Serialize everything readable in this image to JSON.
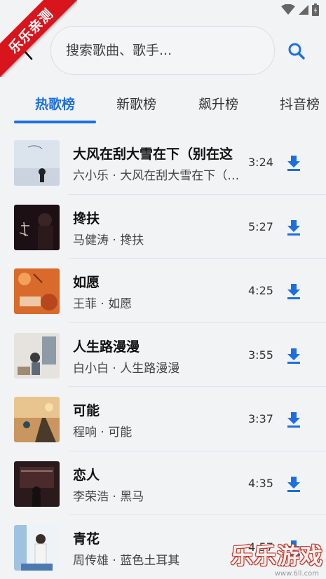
{
  "ribbon": {
    "label": "乐乐亲测"
  },
  "search": {
    "placeholder": "搜索歌曲、歌手..."
  },
  "tabs": [
    {
      "label": "热歌榜",
      "active": true
    },
    {
      "label": "新歌榜",
      "active": false
    },
    {
      "label": "飙升榜",
      "active": false
    },
    {
      "label": "抖音榜",
      "active": false
    }
  ],
  "songs": [
    {
      "title": "大风在刮大雪在下（别在这",
      "subtitle": "六小乐 · 大风在刮大雪在下（…",
      "duration": "3:24"
    },
    {
      "title": "搀扶",
      "subtitle": "马健涛 · 搀扶",
      "duration": "5:27"
    },
    {
      "title": "如愿",
      "subtitle": "王菲 · 如愿",
      "duration": "4:25"
    },
    {
      "title": "人生路漫漫",
      "subtitle": "白小白 · 人生路漫漫",
      "duration": "3:55"
    },
    {
      "title": "可能",
      "subtitle": "程响 · 可能",
      "duration": "3:37"
    },
    {
      "title": "恋人",
      "subtitle": "李荣浩 · 黑马",
      "duration": "4:35"
    },
    {
      "title": "青花",
      "subtitle": "周传雄 · 蓝色土耳其",
      "duration": "4:57"
    }
  ],
  "watermark": {
    "text": "乐乐游戏",
    "url": "www.6ll.com"
  },
  "colors": {
    "accent": "#1d6fe0",
    "ribbon": "#d8141c",
    "background": "#f2f3f5"
  }
}
